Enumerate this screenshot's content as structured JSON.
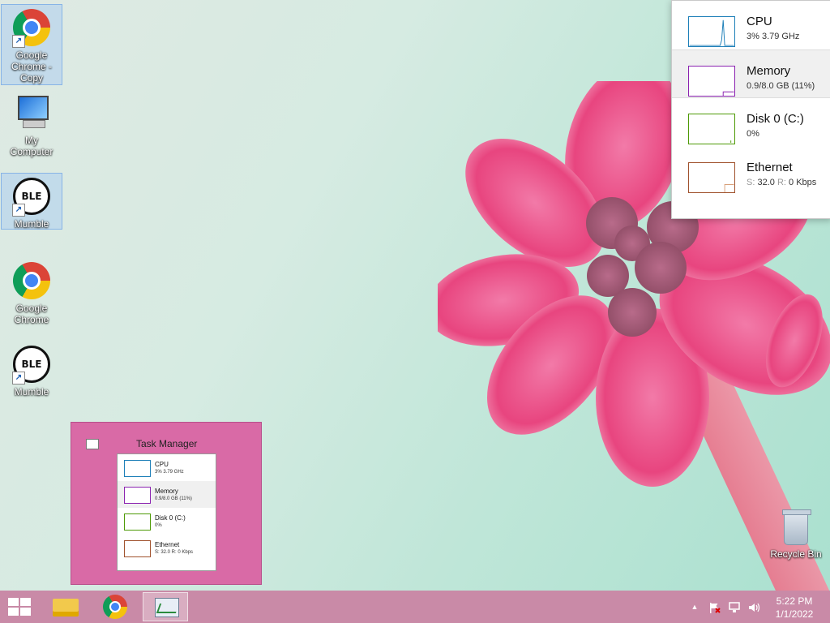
{
  "desktop": {
    "icons": [
      {
        "label": "Google Chrome - Copy",
        "icon": "chrome-icon"
      },
      {
        "label": "My Computer",
        "icon": "computer-icon"
      },
      {
        "label": "Mumble",
        "icon": "mumble-icon"
      },
      {
        "label": "Google Chrome",
        "icon": "chrome-icon"
      },
      {
        "label": "Mumble",
        "icon": "mumble-icon"
      },
      {
        "label": "Recycle Bin",
        "icon": "recycle-bin-icon"
      }
    ],
    "mumble_logo_text": "BLE"
  },
  "perf_panel": {
    "rows": [
      {
        "title": "CPU",
        "sub": "3% 3.79 GHz",
        "color": "#1d7fb8"
      },
      {
        "title": "Memory",
        "sub": "0.9/8.0 GB (11%)",
        "color": "#8b22b0"
      },
      {
        "title": "Disk 0 (C:)",
        "sub": "0%",
        "color": "#4e9a06"
      },
      {
        "title": "Ethernet",
        "sub_s_label": "S:",
        "sub_s_value": "32.0",
        "sub_r_label": "R:",
        "sub_r_value": "0 Kbps",
        "color": "#a0522d"
      }
    ]
  },
  "thumbnail": {
    "title": "Task Manager",
    "rows": [
      {
        "title": "CPU",
        "sub": "3% 3.79 GHz"
      },
      {
        "title": "Memory",
        "sub": "0.9/8.0 GB (11%)"
      },
      {
        "title": "Disk 0 (C:)",
        "sub": "0%"
      },
      {
        "title": "Ethernet",
        "sub": "S: 32.0 R: 0 Kbps"
      }
    ]
  },
  "taskbar": {
    "start": "start-icon",
    "pinned": [
      "file-explorer-icon",
      "chrome-icon",
      "task-manager-icon"
    ],
    "tray": {
      "overflow": "▲",
      "icons": [
        "action-center-flag-icon",
        "network-icon",
        "volume-icon"
      ]
    },
    "clock": {
      "time": "5:22 PM",
      "date": "1/1/2022"
    }
  },
  "colors": {
    "taskbar": "#c98aa7",
    "thumbnail": "#d96aa6"
  }
}
